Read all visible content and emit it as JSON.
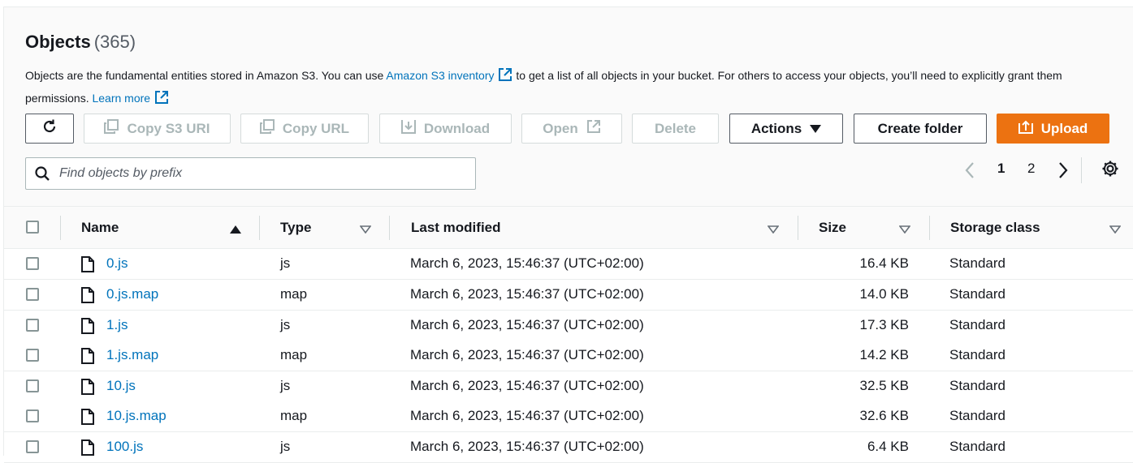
{
  "header": {
    "title": "Objects",
    "count": "(365)",
    "desc_part1": "Objects are the fundamental entities stored in Amazon S3. You can use ",
    "desc_link1": "Amazon S3 inventory",
    "desc_part2": " to get a list of all objects in your bucket. For others to access your objects, you’ll need to explicitly grant them permissions. ",
    "desc_link2": "Learn more"
  },
  "toolbar": {
    "copy_s3_uri": "Copy S3 URI",
    "copy_url": "Copy URL",
    "download": "Download",
    "open": "Open",
    "delete": "Delete",
    "actions": "Actions",
    "create_folder": "Create folder",
    "upload": "Upload"
  },
  "search": {
    "placeholder": "Find objects by prefix",
    "value": ""
  },
  "pagination": {
    "pages": [
      "1",
      "2"
    ],
    "current": "1"
  },
  "columns": {
    "name": "Name",
    "type": "Type",
    "last_modified": "Last modified",
    "size": "Size",
    "storage_class": "Storage class"
  },
  "rows": [
    {
      "name": "0.js",
      "type": "js",
      "modified": "March 6, 2023, 15:46:37 (UTC+02:00)",
      "size": "16.4 KB",
      "storage": "Standard"
    },
    {
      "name": "0.js.map",
      "type": "map",
      "modified": "March 6, 2023, 15:46:37 (UTC+02:00)",
      "size": "14.0 KB",
      "storage": "Standard"
    },
    {
      "name": "1.js",
      "type": "js",
      "modified": "March 6, 2023, 15:46:37 (UTC+02:00)",
      "size": "17.3 KB",
      "storage": "Standard"
    },
    {
      "name": "1.js.map",
      "type": "map",
      "modified": "March 6, 2023, 15:46:37 (UTC+02:00)",
      "size": "14.2 KB",
      "storage": "Standard"
    },
    {
      "name": "10.js",
      "type": "js",
      "modified": "March 6, 2023, 15:46:37 (UTC+02:00)",
      "size": "32.5 KB",
      "storage": "Standard"
    },
    {
      "name": "10.js.map",
      "type": "map",
      "modified": "March 6, 2023, 15:46:37 (UTC+02:00)",
      "size": "32.6 KB",
      "storage": "Standard"
    },
    {
      "name": "100.js",
      "type": "js",
      "modified": "March 6, 2023, 15:46:37 (UTC+02:00)",
      "size": "6.4 KB",
      "storage": "Standard"
    }
  ],
  "colors": {
    "link": "#0073bb",
    "upload": "#ec7211",
    "disabled": "#aab7b8"
  }
}
